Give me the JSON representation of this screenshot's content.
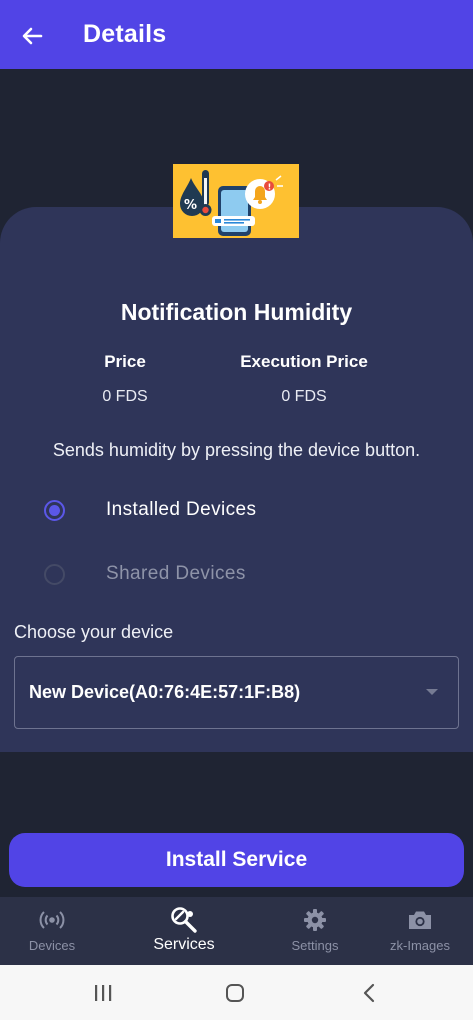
{
  "header": {
    "title": "Details",
    "back_icon": "arrow-left-icon"
  },
  "hero": {
    "icon": "humidity-notification-illustration",
    "background_color": "#fec131"
  },
  "service": {
    "name": "Notification Humidity",
    "price_label": "Price",
    "price_value": "0 FDS",
    "execution_price_label": "Execution Price",
    "execution_price_value": "0 FDS",
    "description": "Sends humidity by pressing the device button."
  },
  "device_source": {
    "options": [
      {
        "label": "Installed Devices",
        "selected": true
      },
      {
        "label": "Shared Devices",
        "selected": false
      }
    ]
  },
  "device_select": {
    "label": "Choose your device",
    "value": "New Device(A0:76:4E:57:1F:B8)"
  },
  "install_button": {
    "label": "Install Service"
  },
  "bottom_nav": {
    "items": [
      {
        "label": "Devices",
        "icon": "broadcast-icon",
        "active": false
      },
      {
        "label": "Services",
        "icon": "services-icon",
        "active": true
      },
      {
        "label": "Settings",
        "icon": "gear-icon",
        "active": false
      },
      {
        "label": "zk-Images",
        "icon": "camera-icon",
        "active": false
      }
    ]
  },
  "system_nav": {
    "buttons": [
      "recent-apps-icon",
      "home-icon",
      "back-icon"
    ]
  },
  "colors": {
    "accent": "#5144e6",
    "background": "#1f2433",
    "card": "#2f3559"
  }
}
